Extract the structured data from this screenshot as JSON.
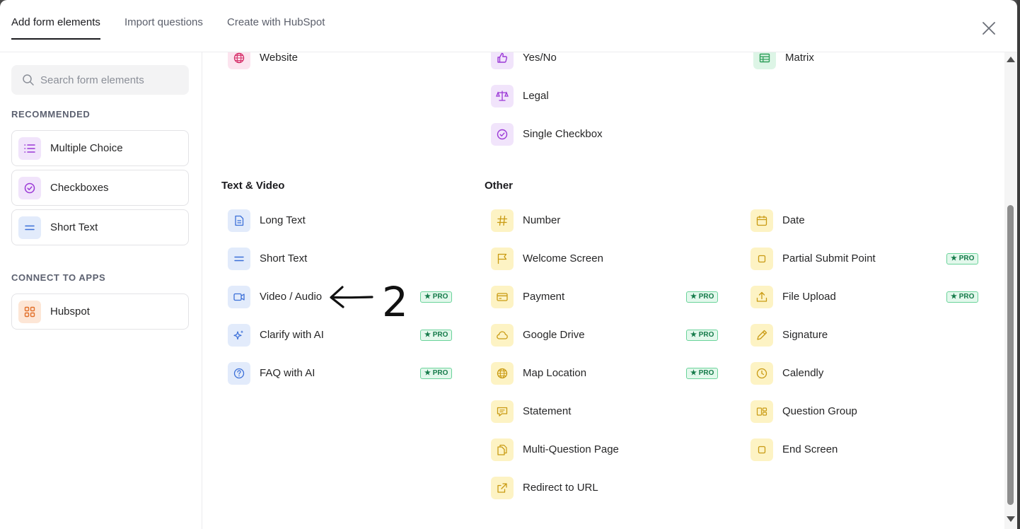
{
  "tabs": [
    {
      "label": "Add form elements",
      "active": true
    },
    {
      "label": "Import questions",
      "active": false
    },
    {
      "label": "Create with HubSpot",
      "active": false
    }
  ],
  "sidebar": {
    "search_placeholder": "Search form elements",
    "recommended_heading": "RECOMMENDED",
    "recommended": [
      {
        "label": "Multiple Choice",
        "icon": "list-icon"
      },
      {
        "label": "Checkboxes",
        "icon": "check-circle-icon"
      },
      {
        "label": "Short Text",
        "icon": "short-text-icon"
      }
    ],
    "connect_heading": "CONNECT TO APPS",
    "apps": [
      {
        "label": "Hubspot",
        "icon": "grid-icon"
      }
    ]
  },
  "main": {
    "top_items": [
      {
        "label": "Website",
        "icon": "globe-icon"
      },
      {
        "label": "Yes/No",
        "icon": "thumbs-up-icon"
      },
      {
        "label": "Matrix",
        "icon": "table-icon"
      },
      {
        "label": "Legal",
        "icon": "scales-icon"
      },
      {
        "label": "Single Checkbox",
        "icon": "check-circle-icon"
      }
    ],
    "text_video_heading": "Text & Video",
    "other_heading": "Other",
    "text_video_items": [
      {
        "label": "Long Text",
        "icon": "document-icon",
        "pro": false
      },
      {
        "label": "Short Text",
        "icon": "short-text-icon",
        "pro": false
      },
      {
        "label": "Video / Audio",
        "icon": "video-icon",
        "pro": true
      },
      {
        "label": "Clarify with AI",
        "icon": "sparkle-icon",
        "pro": true
      },
      {
        "label": "FAQ with AI",
        "icon": "question-icon",
        "pro": true
      }
    ],
    "other_col1": [
      {
        "label": "Number",
        "icon": "hash-icon",
        "pro": false
      },
      {
        "label": "Welcome Screen",
        "icon": "flag-icon",
        "pro": false
      },
      {
        "label": "Payment",
        "icon": "credit-card-icon",
        "pro": true
      },
      {
        "label": "Google Drive",
        "icon": "cloud-icon",
        "pro": true
      },
      {
        "label": "Map Location",
        "icon": "globe-icon",
        "pro": true
      },
      {
        "label": "Statement",
        "icon": "chat-icon",
        "pro": false
      },
      {
        "label": "Multi-Question Page",
        "icon": "copy-icon",
        "pro": false
      },
      {
        "label": "Redirect to URL",
        "icon": "external-link-icon",
        "pro": false
      }
    ],
    "other_col2": [
      {
        "label": "Date",
        "icon": "calendar-icon",
        "pro": false
      },
      {
        "label": "Partial Submit Point",
        "icon": "square-icon",
        "pro": true
      },
      {
        "label": "File Upload",
        "icon": "upload-icon",
        "pro": true
      },
      {
        "label": "Signature",
        "icon": "pencil-icon",
        "pro": false
      },
      {
        "label": "Calendly",
        "icon": "clock-icon",
        "pro": false
      },
      {
        "label": "Question Group",
        "icon": "group-icon",
        "pro": false
      },
      {
        "label": "End Screen",
        "icon": "square-icon",
        "pro": false
      }
    ],
    "pro_label": "★ PRO"
  },
  "annotation": {
    "number": "2",
    "icon": "arrow-left-icon"
  },
  "colors": {
    "purple_bg": "#f1e4fb",
    "purple_fg": "#9b38d6",
    "pink_bg": "#fce4ef",
    "pink_fg": "#d6336c",
    "green_bg": "#ddf5e6",
    "green_fg": "#2f9e5a",
    "blue_bg": "#e2ebfb",
    "blue_fg": "#3b6fd8",
    "yellow_bg": "#fdf3c4",
    "yellow_fg": "#c99a12",
    "orange_bg": "#fde6d6",
    "orange_fg": "#e2702a",
    "pro_green": "#147a49"
  }
}
